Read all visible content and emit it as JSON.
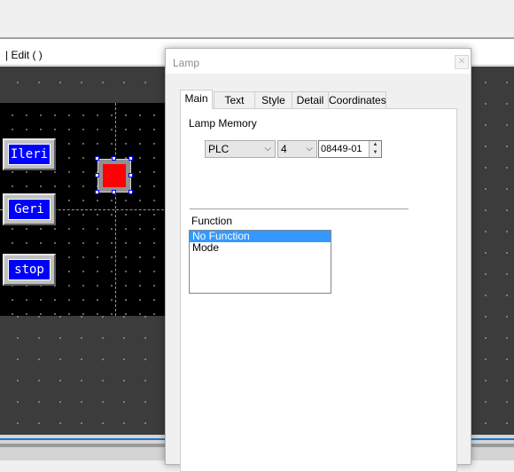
{
  "editor": {
    "title_text": "| Edit (              )"
  },
  "screen": {
    "buttons": [
      {
        "label": "Ileri"
      },
      {
        "label": "Geri"
      },
      {
        "label": "stop"
      }
    ]
  },
  "dialog": {
    "title": "Lamp",
    "close_icon": "close-icon",
    "close_glyph": "✕",
    "tabs": [
      {
        "label": "Main",
        "active": true
      },
      {
        "label": "Text"
      },
      {
        "label": "Style"
      },
      {
        "label": "Detail"
      },
      {
        "label": "Coordinates"
      }
    ],
    "lamp_memory": {
      "label": "Lamp Memory",
      "device_type": "PLC",
      "station": "4",
      "address": "08449-01"
    },
    "function": {
      "label": "Function",
      "options": [
        "No Function",
        "Mode"
      ],
      "selected": "No Function"
    }
  },
  "colors": {
    "screen_background": "#000000",
    "button_face": "#0000ff",
    "lamp_on": "#ff0000",
    "selection_highlight": "#3399ff"
  }
}
